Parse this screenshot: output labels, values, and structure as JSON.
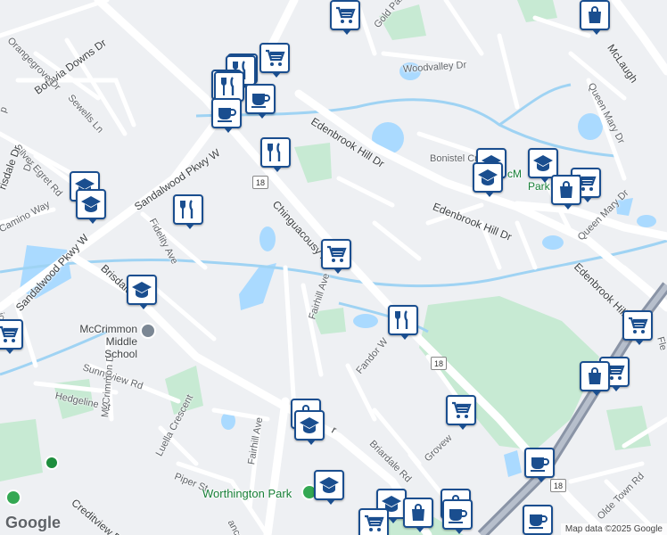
{
  "map": {
    "colors": {
      "background": "#eef0f3",
      "road": "#ffffff",
      "highway": "#8a94a6",
      "water": "#aadaff",
      "stream": "#9fd3f3",
      "park": "#c7ead3",
      "pin_border": "#1a4e8f"
    },
    "streets": [
      {
        "key": "botavia",
        "text": "Botavia Downs Dr"
      },
      {
        "key": "sewells",
        "text": "Sewells Ln"
      },
      {
        "key": "orangegrove",
        "text": "Orangegrove Dr"
      },
      {
        "key": "silver_egret",
        "text": "Silver Egret Rd"
      },
      {
        "key": "brisdale_nw",
        "text": "risdale Dr"
      },
      {
        "key": "camino",
        "text": "Camino Way"
      },
      {
        "key": "victoria",
        "text": "ictoria Dr"
      },
      {
        "key": "sandalwood_w1",
        "text": "Sandalwood Pkwy W"
      },
      {
        "key": "sandalwood_w2",
        "text": "Sandalwood Pkwy W"
      },
      {
        "key": "brisdale",
        "text": "Brisdale Dr"
      },
      {
        "key": "fidelity",
        "text": "Fidelity Ave"
      },
      {
        "key": "chinguacousy",
        "text": "Chinguacousy Rd"
      },
      {
        "key": "fairhill1",
        "text": "Fairhill Ave"
      },
      {
        "key": "fairhill2",
        "text": "Fairhill Ave"
      },
      {
        "key": "sunnyview",
        "text": "Sunnyview Rd"
      },
      {
        "key": "mccrimmon_dr",
        "text": "McCrimmon Dr"
      },
      {
        "key": "hedgeline",
        "text": "Hedgeline St"
      },
      {
        "key": "luella",
        "text": "Luella Crescent"
      },
      {
        "key": "piper",
        "text": "Piper St"
      },
      {
        "key": "spencer",
        "text": "ancer Dr"
      },
      {
        "key": "creditview",
        "text": "Creditview R"
      },
      {
        "key": "edenbrook1",
        "text": "Edenbrook Hill Dr"
      },
      {
        "key": "edenbrook2",
        "text": "Edenbrook Hill Dr"
      },
      {
        "key": "edenbrook3",
        "text": "Edenbrook Hill Dr"
      },
      {
        "key": "woodvalley",
        "text": "Woodvalley Dr"
      },
      {
        "key": "gold_park",
        "text": "Gold Park"
      },
      {
        "key": "bonistel",
        "text": "Bonistel Cres"
      },
      {
        "key": "queen_mary1",
        "text": "Queen Mary Dr"
      },
      {
        "key": "queen_mary2",
        "text": "Queen Mary Dr"
      },
      {
        "key": "mclaughlin",
        "text": "McLaugh"
      },
      {
        "key": "fandor",
        "text": "Fandor W"
      },
      {
        "key": "briardale",
        "text": "Briardale Rd"
      },
      {
        "key": "grovewood",
        "text": "Grovew"
      },
      {
        "key": "olde_town",
        "text": "Olde Town Rd"
      },
      {
        "key": "fle",
        "text": "Fle"
      },
      {
        "key": "edenbrook_low",
        "text": "r"
      },
      {
        "key": "dr_left",
        "text": "Dr"
      },
      {
        "key": "ep",
        "text": "p"
      }
    ],
    "places": {
      "mccrimmon_school": "McCrimmon Middle School",
      "worthington_park": "Worthington Park",
      "mcm_park": "cM",
      "park_suffix": "Park"
    },
    "route_shields": [
      "18",
      "18",
      "18",
      "18"
    ],
    "pins": [
      {
        "type": "shopping-cart",
        "name": "grocery-pin"
      },
      {
        "type": "shopping-bag",
        "name": "store-pin"
      },
      {
        "type": "shopping-cart",
        "name": "grocery-pin"
      },
      {
        "type": "shopping-cart",
        "name": "grocery-pin"
      },
      {
        "type": "restaurant",
        "name": "restaurant-pin"
      },
      {
        "type": "shopping-cart",
        "name": "grocery-pin"
      },
      {
        "type": "restaurant",
        "name": "restaurant-pin"
      },
      {
        "type": "cafe",
        "name": "cafe-pin"
      },
      {
        "type": "cafe",
        "name": "cafe-pin"
      },
      {
        "type": "restaurant",
        "name": "restaurant-pin"
      },
      {
        "type": "school",
        "name": "school-pin"
      },
      {
        "type": "school",
        "name": "school-pin"
      },
      {
        "type": "restaurant",
        "name": "restaurant-pin"
      },
      {
        "type": "shopping-cart",
        "name": "grocery-pin"
      },
      {
        "type": "school",
        "name": "school-pin"
      },
      {
        "type": "restaurant",
        "name": "restaurant-pin"
      },
      {
        "type": "school",
        "name": "school-pin"
      },
      {
        "type": "school",
        "name": "school-pin"
      },
      {
        "type": "school",
        "name": "school-pin"
      },
      {
        "type": "shopping-cart",
        "name": "grocery-pin"
      },
      {
        "type": "shopping-bag",
        "name": "store-pin"
      },
      {
        "type": "shopping-cart",
        "name": "grocery-pin"
      },
      {
        "type": "shopping-cart",
        "name": "grocery-pin"
      },
      {
        "type": "shopping-bag",
        "name": "store-pin"
      },
      {
        "type": "shopping-cart",
        "name": "grocery-pin"
      },
      {
        "type": "shopping-bag",
        "name": "store-pin"
      },
      {
        "type": "school",
        "name": "school-pin"
      },
      {
        "type": "school",
        "name": "school-pin"
      },
      {
        "type": "school",
        "name": "school-pin"
      },
      {
        "type": "shopping-bag",
        "name": "store-pin"
      },
      {
        "type": "shopping-cart",
        "name": "grocery-pin"
      },
      {
        "type": "shopping-bag",
        "name": "store-pin"
      },
      {
        "type": "cafe",
        "name": "cafe-pin"
      },
      {
        "type": "cafe",
        "name": "cafe-pin"
      },
      {
        "type": "cafe",
        "name": "cafe-pin"
      },
      {
        "type": "shopping-cart",
        "name": "grocery-pin"
      }
    ],
    "branding": {
      "logo": "Google",
      "attribution": "Map data ©2025 Google"
    }
  }
}
